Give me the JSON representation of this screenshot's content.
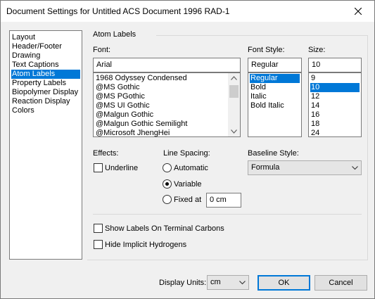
{
  "window": {
    "title": "Document Settings for Untitled ACS Document 1996 RAD-1",
    "close_icon": "close-icon"
  },
  "sidebar": {
    "items": [
      {
        "label": "Layout",
        "selected": false
      },
      {
        "label": "Header/Footer",
        "selected": false
      },
      {
        "label": "Drawing",
        "selected": false
      },
      {
        "label": "Text Captions",
        "selected": false
      },
      {
        "label": "Atom Labels",
        "selected": true
      },
      {
        "label": "Property Labels",
        "selected": false
      },
      {
        "label": "Biopolymer Display",
        "selected": false
      },
      {
        "label": "Reaction Display",
        "selected": false
      },
      {
        "label": "Colors",
        "selected": false
      }
    ]
  },
  "panel": {
    "group_title": "Atom Labels",
    "font": {
      "label": "Font:",
      "value": "Arial",
      "options": [
        "1968 Odyssey Condensed",
        "@MS Gothic",
        "@MS PGothic",
        "@MS UI Gothic",
        "@Malgun Gothic",
        "@Malgun Gothic Semilight",
        "@Microsoft JhengHei"
      ]
    },
    "font_style": {
      "label": "Font Style:",
      "value": "Regular",
      "options": [
        "Regular",
        "Bold",
        "Italic",
        "Bold Italic"
      ],
      "selected": "Regular"
    },
    "size": {
      "label": "Size:",
      "value": "10",
      "options": [
        "9",
        "10",
        "12",
        "14",
        "16",
        "18",
        "24"
      ],
      "selected": "10"
    },
    "effects": {
      "label": "Effects:",
      "underline_label": "Underline",
      "underline_checked": false
    },
    "line_spacing": {
      "label": "Line Spacing:",
      "automatic_label": "Automatic",
      "variable_label": "Variable",
      "fixed_label": "Fixed at",
      "fixed_value": "0 cm",
      "selected": "Variable"
    },
    "baseline": {
      "label": "Baseline Style:",
      "value": "Formula"
    },
    "show_labels_terminal": {
      "label": "Show Labels On Terminal Carbons",
      "checked": false
    },
    "hide_implicit_h": {
      "label": "Hide Implicit Hydrogens",
      "checked": false
    }
  },
  "footer": {
    "display_units_label": "Display Units:",
    "display_units_value": "cm",
    "ok_label": "OK",
    "cancel_label": "Cancel"
  }
}
